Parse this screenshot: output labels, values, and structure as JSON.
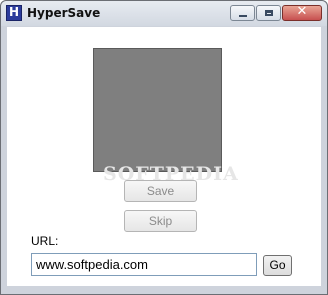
{
  "window": {
    "title": "HyperSave",
    "icon": "hypersave-app-icon",
    "icon_letter": "H",
    "controls": {
      "minimize": "minimize-icon",
      "maximize": "maximize-icon",
      "close": "close-icon",
      "close_glyph": "✕"
    }
  },
  "preview": {
    "fill_color": "#7f7f7f",
    "watermark": "SOFTPEDIA"
  },
  "actions": {
    "save_label": "Save",
    "skip_label": "Skip",
    "save_enabled": false,
    "skip_enabled": false
  },
  "url": {
    "label": "URL:",
    "value": "www.softpedia.com",
    "go_label": "Go"
  },
  "colors": {
    "disabled_text": "#8b8b8b",
    "input_border": "#7f9db9",
    "close_button": "#c75050"
  }
}
